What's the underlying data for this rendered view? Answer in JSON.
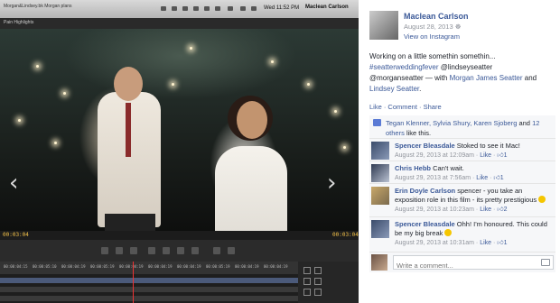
{
  "viewer": {
    "menubar": {
      "tabs_text": "Morgan&Lindsey.bk  Morgan plans",
      "clock": "Wed 11:52 PM",
      "user": "Maclean Carlson"
    },
    "editor_label": "Pain Highlights",
    "prev_icon": "chevron-left-icon",
    "next_icon": "chevron-right-icon",
    "timecode_left": "00:03:04",
    "timecode_right": "00:03:04",
    "ruler_labels": [
      "00:00:04:15",
      "00:00:05:10",
      "00:00:04:19",
      "00:00:05:19",
      "00:00:04:19",
      "00:00:04:19",
      "00:00:04:19",
      "00:00:05:19",
      "00:00:04:19",
      "00:00:04:19",
      "00:00:04:17"
    ]
  },
  "post": {
    "author": "Maclean Carlson",
    "date": "August 28, 2013",
    "via": "View on Instagram",
    "text_before": "Working on a little somethin somethin... ",
    "hashtag": "#seatterweddingfever",
    "tag1": " @lindseyseatter",
    "tag2": "@morganseatter",
    "with_text": " — with ",
    "with_person1": "Morgan James Seatter",
    "and_text": " and ",
    "with_person2": "Lindsey Seatter",
    "period": ".",
    "actions": "Like · Comment · Share",
    "likes_names": "Tegan Klenner, Sylvia Shury, Karen Sjoberg",
    "likes_and": " and ",
    "likes_others": "12 others",
    "likes_suffix": " like this.",
    "reply_placeholder": "Write a comment..."
  },
  "comments": [
    {
      "name": "Spencer Bleasdale",
      "text": "Stoked to see it Mac!",
      "time": "August 29, 2013 at 12:09am",
      "like": "Like",
      "count": "1"
    },
    {
      "name": "Chris Hebb",
      "text": "Can't wait.",
      "time": "August 29, 2013 at 7:56am",
      "like": "Like",
      "count": "1"
    },
    {
      "name": "Erin Doyle Carlson",
      "text": "spencer - you take an exposition role in this film - its pretty prestigious",
      "time": "August 29, 2013 at 10:23am",
      "like": "Like",
      "count": "2"
    },
    {
      "name": "Spencer Bleasdale",
      "text": "Ohh! I'm honoured. This could be my big break",
      "time": "August 29, 2013 at 10:31am",
      "like": "Like",
      "count": "1"
    }
  ],
  "colors": {
    "link": "#3b5998",
    "meta": "#90949c"
  }
}
